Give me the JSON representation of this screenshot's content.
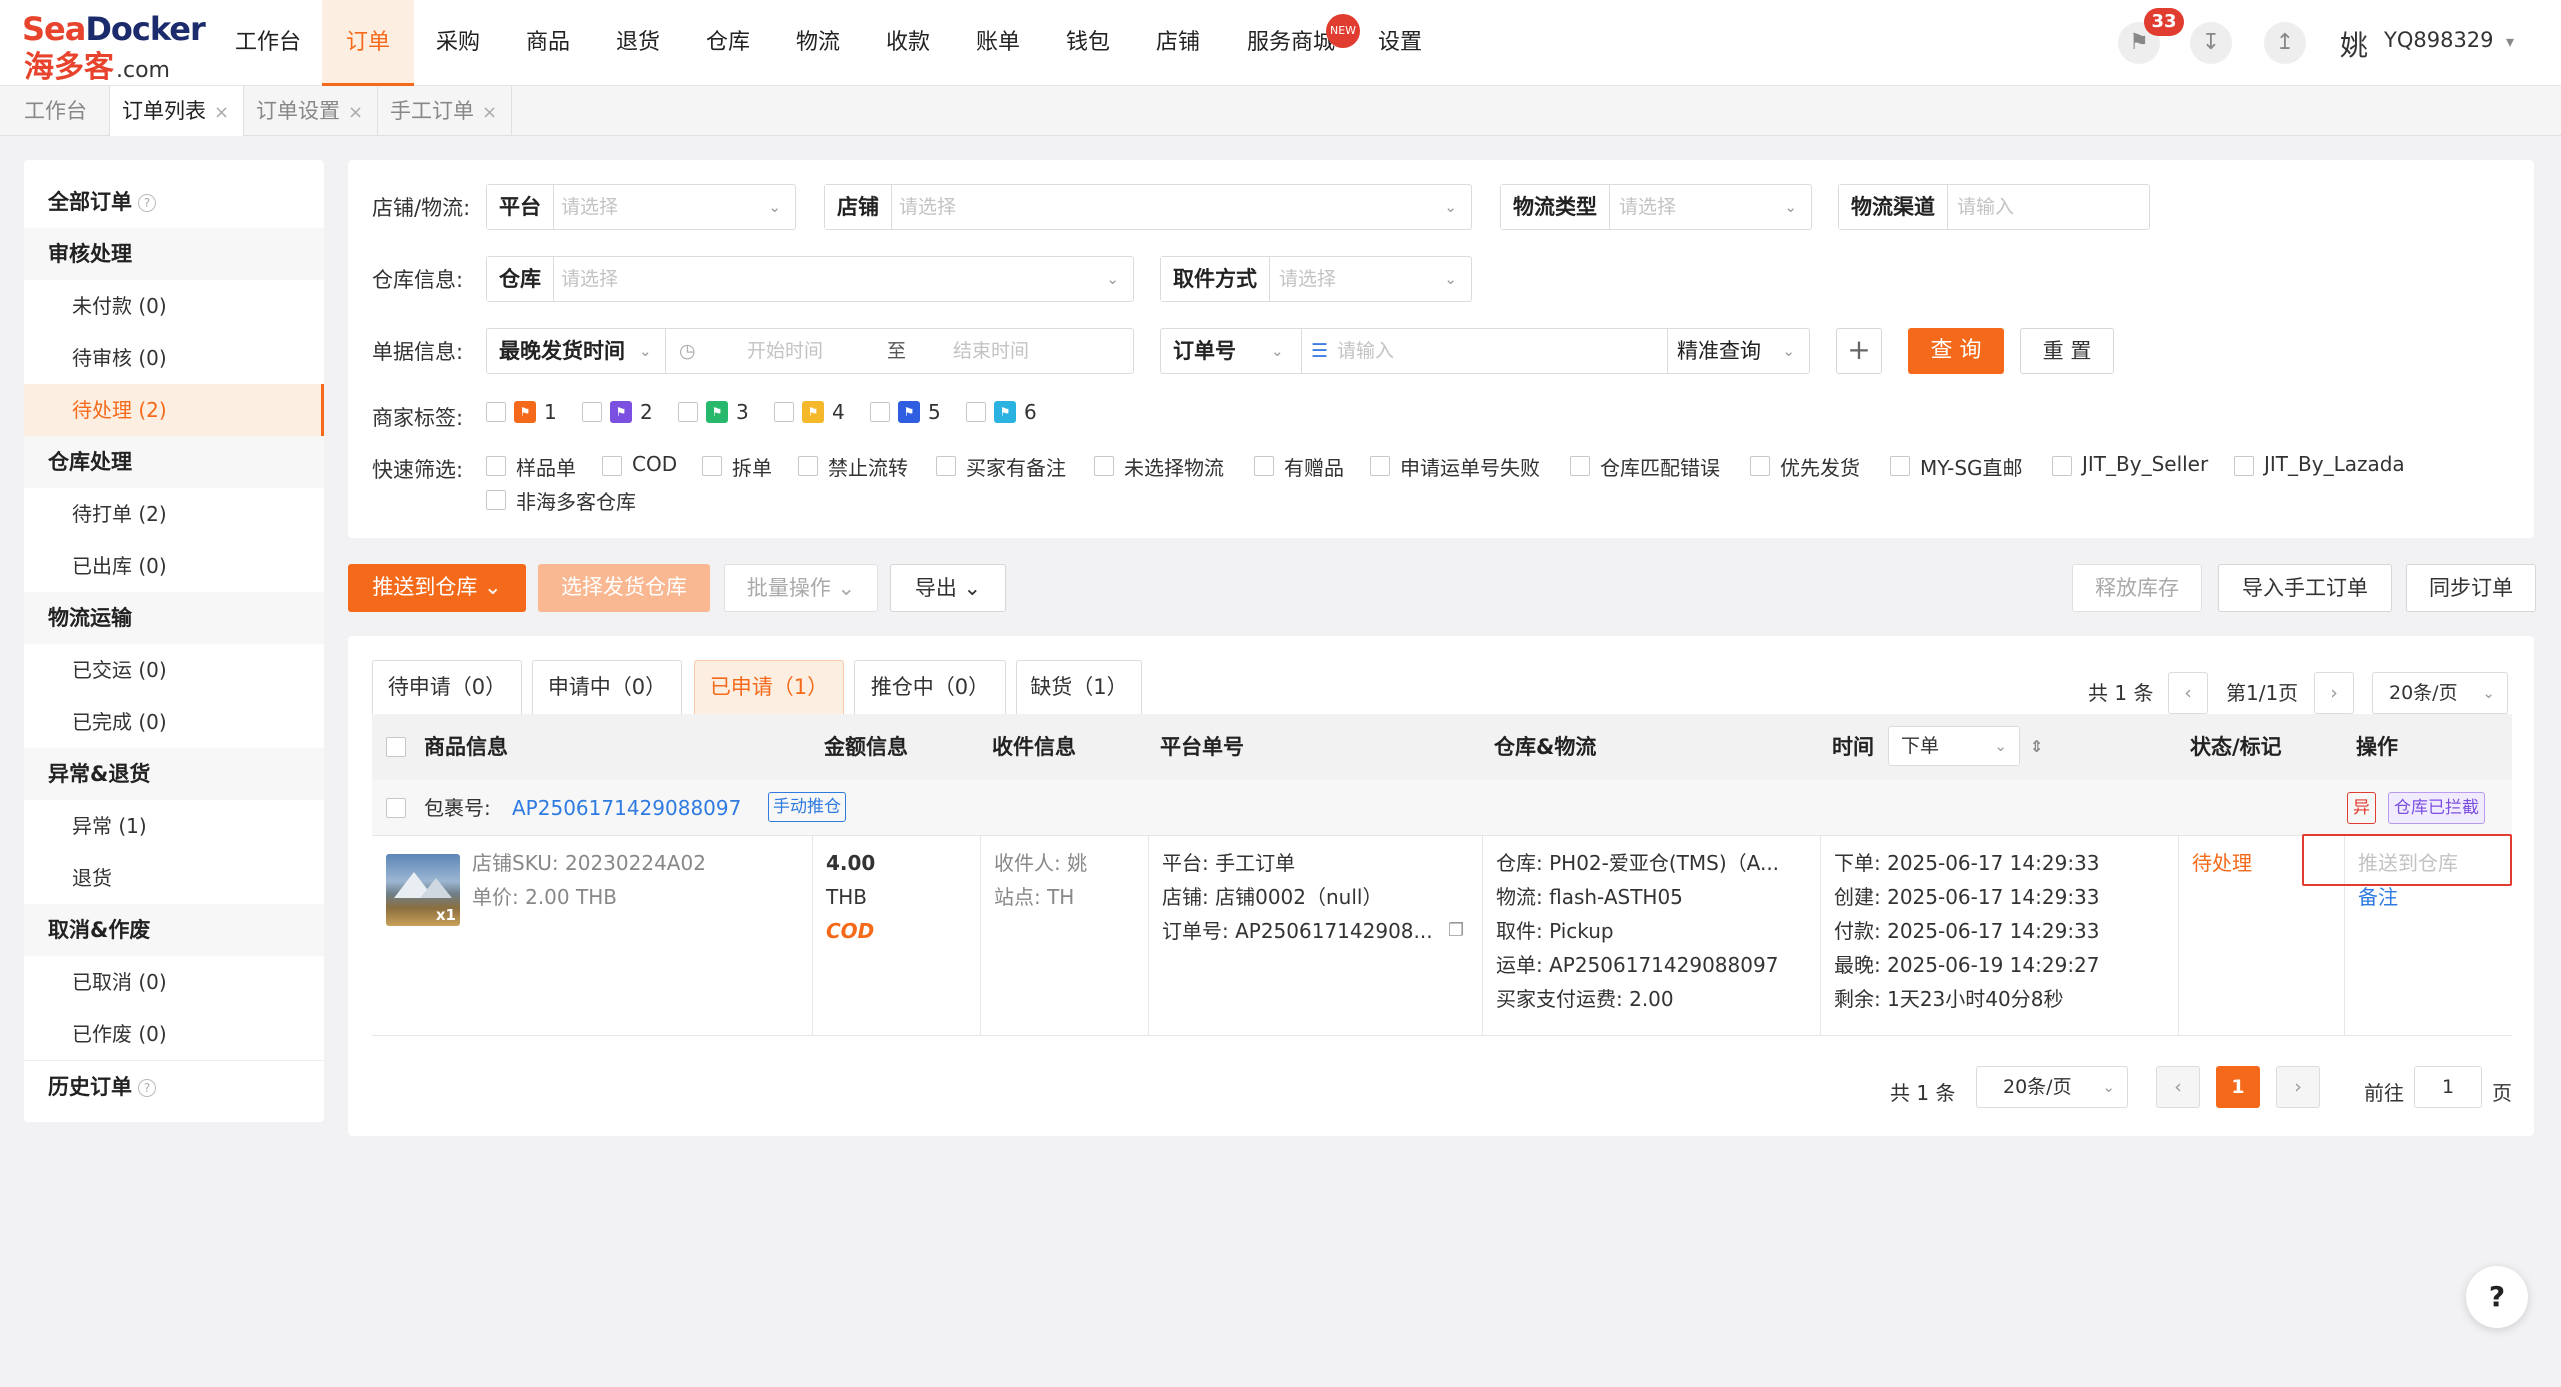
{
  "brand": {
    "en_a": "Sea",
    "en_b": "Docker",
    "cn": "海多客",
    "suffix": ".com"
  },
  "nav": {
    "items": [
      "工作台",
      "订单",
      "采购",
      "商品",
      "退货",
      "仓库",
      "物流",
      "收款",
      "账单",
      "钱包",
      "店铺",
      "服务商城",
      "设置"
    ],
    "active": "订单",
    "new_badge": "NEW"
  },
  "topright": {
    "notice_count": "33",
    "username": "YQ898329",
    "user_glyph": "姚"
  },
  "page_tabs": [
    {
      "label": "工作台",
      "closable": false
    },
    {
      "label": "订单列表",
      "closable": true,
      "active": true
    },
    {
      "label": "订单设置",
      "closable": true
    },
    {
      "label": "手工订单",
      "closable": true
    }
  ],
  "sidebar": {
    "all_orders": "全部订单",
    "groups": [
      {
        "title": "审核处理",
        "items": [
          "未付款 (0)",
          "待审核 (0)",
          "待处理 (2)"
        ]
      },
      {
        "title": "仓库处理",
        "items": [
          "待打单 (2)",
          "已出库 (0)"
        ]
      },
      {
        "title": "物流运输",
        "items": [
          "已交运 (0)",
          "已完成 (0)"
        ]
      },
      {
        "title": "异常&退货",
        "items": [
          "异常 (1)",
          "退货"
        ]
      },
      {
        "title": "取消&作废",
        "items": [
          "已取消 (0)",
          "已作废 (0)"
        ]
      }
    ],
    "history": "历史订单",
    "active_item": "待处理 (2)"
  },
  "filters": {
    "shop_logistics_label": "店铺/物流:",
    "platform_label": "平台",
    "platform_ph": "请选择",
    "shop_label": "店铺",
    "shop_ph": "请选择",
    "logistics_type_label": "物流类型",
    "logistics_type_ph": "请选择",
    "logistics_channel_label": "物流渠道",
    "logistics_channel_ph": "请输入",
    "warehouse_info_label": "仓库信息:",
    "warehouse_label": "仓库",
    "warehouse_ph": "请选择",
    "pickup_label": "取件方式",
    "pickup_ph": "请选择",
    "doc_info_label": "单据信息:",
    "time_type": "最晚发货时间",
    "start_ph": "开始时间",
    "to": "至",
    "end_ph": "结束时间",
    "order_no_label": "订单号",
    "order_no_ph": "请输入",
    "match_mode": "精准查询",
    "add": "+",
    "query": "查 询",
    "reset": "重 置",
    "merchant_tags_label": "商家标签:",
    "tags": [
      {
        "n": "1",
        "color": "#f56a1a"
      },
      {
        "n": "2",
        "color": "#7b4fe0"
      },
      {
        "n": "3",
        "color": "#27b86b"
      },
      {
        "n": "4",
        "color": "#f5b82a"
      },
      {
        "n": "5",
        "color": "#2f5fe0"
      },
      {
        "n": "6",
        "color": "#2ab3e0"
      }
    ],
    "quick_label": "快速筛选:",
    "quick": [
      "样品单",
      "COD",
      "拆单",
      "禁止流转",
      "买家有备注",
      "未选择物流",
      "有赠品",
      "申请运单号失败",
      "仓库匹配错误",
      "优先发货",
      "MY-SG直邮",
      "JIT_By_Seller",
      "JIT_By_Lazada",
      "非海多客仓库"
    ]
  },
  "actions": {
    "push_warehouse": "推送到仓库",
    "select_warehouse": "选择发货仓库",
    "batch": "批量操作",
    "export": "导出",
    "release_stock": "释放库存",
    "import_manual": "导入手工订单",
    "sync": "同步订单"
  },
  "order_tabs": [
    "待申请（0）",
    "申请中（0）",
    "已申请（1）",
    "推仓中（0）",
    "缺货（1）"
  ],
  "order_tab_active": "已申请（1）",
  "pager_top": {
    "total": "共 1 条",
    "page": "第1/1页",
    "size": "20条/页"
  },
  "columns": [
    "商品信息",
    "金额信息",
    "收件信息",
    "平台单号",
    "仓库&物流",
    "时间",
    "状态/标记",
    "操作"
  ],
  "time_sort": "下单",
  "order": {
    "pkg_label": "包裹号:",
    "pkg_no": "AP2506171429088097",
    "pkg_tag": "手动推仓",
    "abn_tag": "异",
    "intercept_tag": "仓库已拦截",
    "qty": "x1",
    "sku": "店铺SKU:  20230224A02",
    "unit_price": "单价:  2.00 THB",
    "amount": "4.00",
    "currency": "THB",
    "cod": "COD",
    "recipient": "收件人:  姚",
    "site": "站点:  TH",
    "platform": "平台:  手工订单",
    "shop": "店铺:  店铺0002（null）",
    "order_no": "订单号:  AP250617142908...",
    "warehouse": "仓库:  PH02-爱亚仓(TMS)（A...",
    "logistics": "物流:  flash-ASTH05",
    "pickup": "取件:  Pickup",
    "waybill": "运单:  AP2506171429088097",
    "buyer_fee": "买家支付运费:  2.00",
    "t_order": "下单:  2025-06-17 14:29:33",
    "t_create": "创建:  2025-06-17 14:29:33",
    "t_pay": "付款:  2025-06-17 14:29:33",
    "t_latest": "最晚:  2025-06-19 14:29:27",
    "t_remain": "剩余:  1天23小时40分8秒",
    "status": "待处理",
    "op_push": "推送到仓库",
    "op_remark": "备注"
  },
  "pager_bottom": {
    "total": "共 1 条",
    "size": "20条/页",
    "page": "1",
    "goto": "前往",
    "goto_val": "1",
    "unit": "页"
  },
  "help": "?"
}
